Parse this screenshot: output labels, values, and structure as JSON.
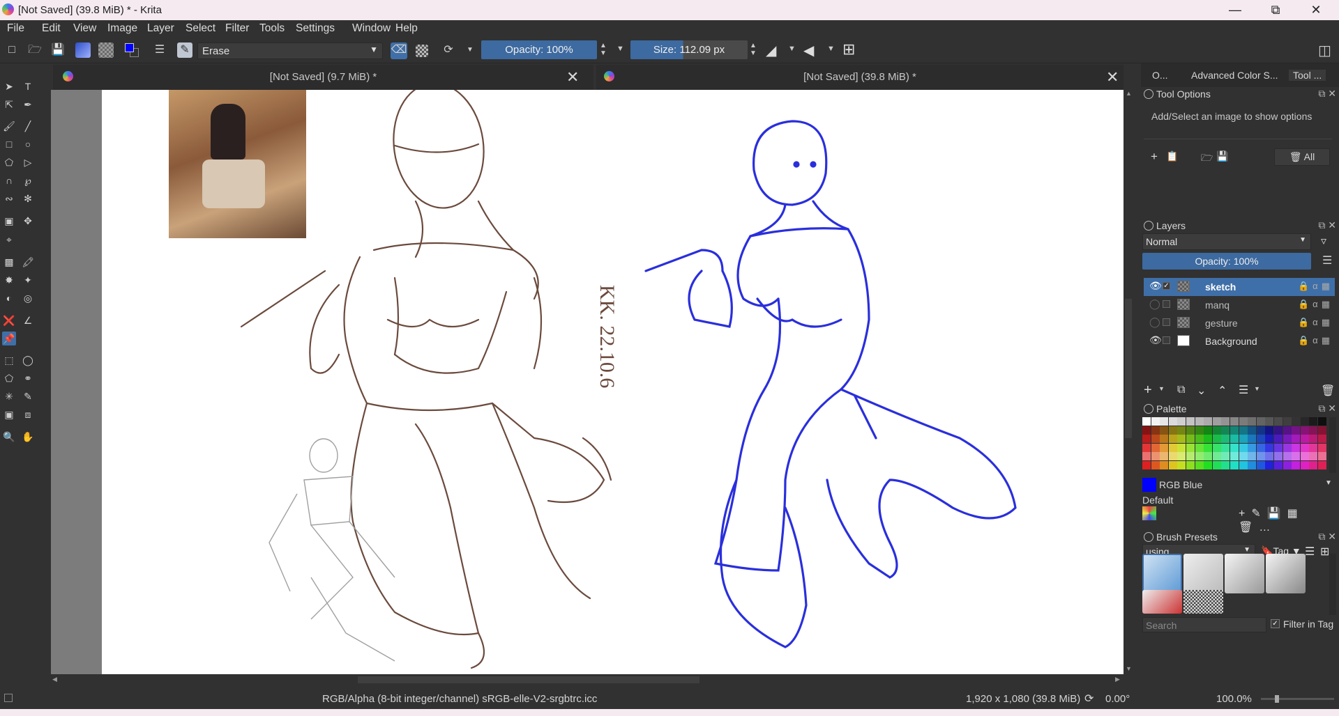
{
  "window": {
    "title": "[Not Saved]  (39.8 MiB) * - Krita",
    "controls": [
      "minimize",
      "restore",
      "close"
    ]
  },
  "menu": [
    "File",
    "Edit",
    "View",
    "Image",
    "Layer",
    "Select",
    "Filter",
    "Tools",
    "Settings",
    "Window",
    "Help"
  ],
  "toolbar": {
    "blend_mode": "Erase",
    "opacity": "Opacity: 100%",
    "opacity_value": 1.0,
    "size": "Size: 112.09 px",
    "size_fill_fraction": 0.45,
    "fg_color": "#0000ff",
    "bg_color": "#000000"
  },
  "documents": [
    {
      "title": "[Not Saved]  (9.7 MiB) *"
    },
    {
      "title": "[Not Saved]  (39.8 MiB) *"
    }
  ],
  "dockers": {
    "top_tabs": [
      "O...",
      "Advanced Color S...",
      "Tool ..."
    ],
    "tool_options": {
      "title": "Tool Options",
      "message": "Add/Select an image to show options",
      "all_label": "All"
    },
    "layers": {
      "title": "Layers",
      "blend_mode": "Normal",
      "opacity": "Opacity:  100%",
      "items": [
        {
          "name": "sketch",
          "selected": true,
          "visible": true
        },
        {
          "name": "manq",
          "selected": false,
          "visible": false
        },
        {
          "name": "gesture",
          "selected": false,
          "visible": false
        },
        {
          "name": "Background",
          "selected": false,
          "visible": true
        }
      ]
    },
    "palette": {
      "title": "Palette",
      "current_color_name": "RGB Blue",
      "current_color": "#0000ff",
      "palette_name": "Default"
    },
    "brush_presets": {
      "title": "Brush Presets",
      "tag": "using",
      "tag_button": "Tag",
      "search_placeholder": "Search",
      "filter_in_tag": "Filter in Tag"
    }
  },
  "statusbar": {
    "color_info": "RGB/Alpha (8-bit integer/channel)  sRGB-elle-V2-srgbtrc.icc",
    "image_info": "1,920 x 1,080 (39.8 MiB)",
    "rotation": "0.00°",
    "zoom": "100.0%"
  },
  "canvas": {
    "annotation_text": "KK. 22.10.6"
  }
}
